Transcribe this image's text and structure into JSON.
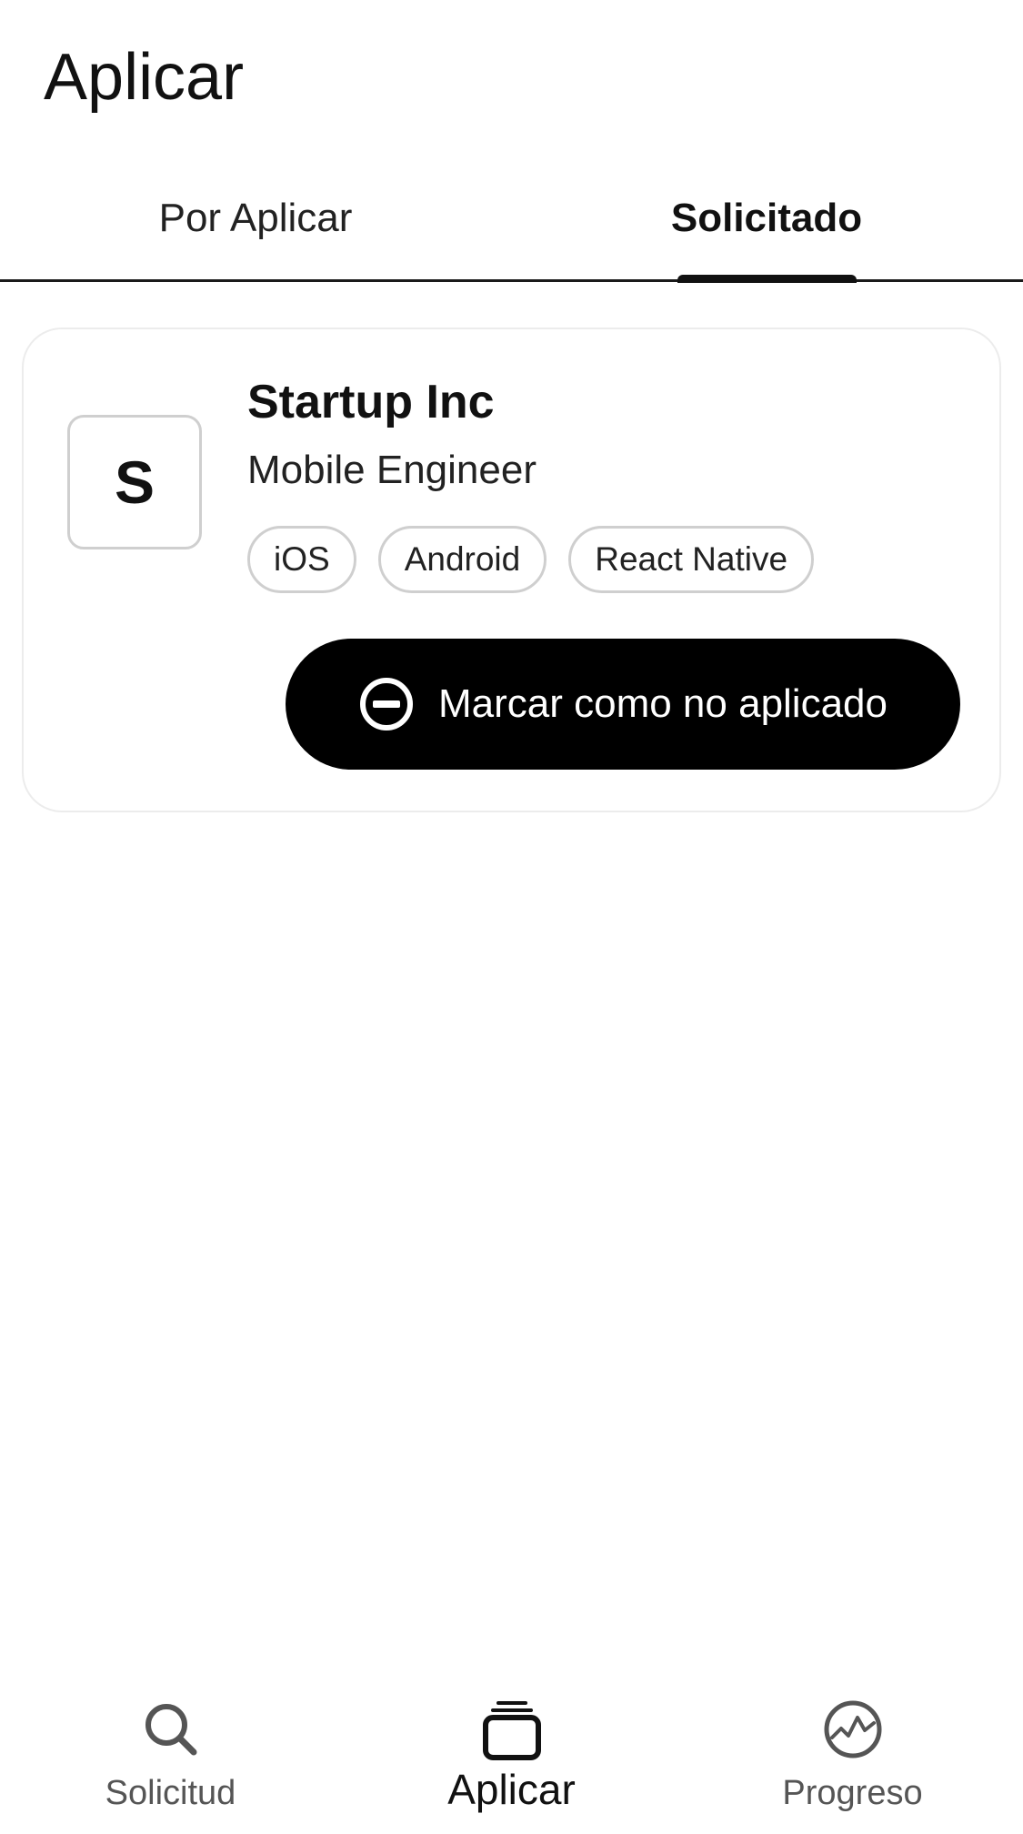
{
  "header": {
    "title": "Aplicar"
  },
  "tabs": [
    {
      "label": "Por Aplicar",
      "active": false
    },
    {
      "label": "Solicitado",
      "active": true
    }
  ],
  "card": {
    "logo_letter": "S",
    "company": "Startup Inc",
    "role": "Mobile Engineer",
    "tags": [
      "iOS",
      "Android",
      "React Native"
    ],
    "action_label": "Marcar como no aplicado",
    "action_icon": "minus-circle-icon"
  },
  "bottom_nav": [
    {
      "label": "Solicitud",
      "icon": "search-icon",
      "active": false
    },
    {
      "label": "Aplicar",
      "icon": "stack-icon",
      "active": true
    },
    {
      "label": "Progreso",
      "icon": "chart-circle-icon",
      "active": false
    }
  ],
  "colors": {
    "primary": "#000000",
    "text": "#111111",
    "muted": "#555555",
    "border": "#cfcfcf"
  }
}
